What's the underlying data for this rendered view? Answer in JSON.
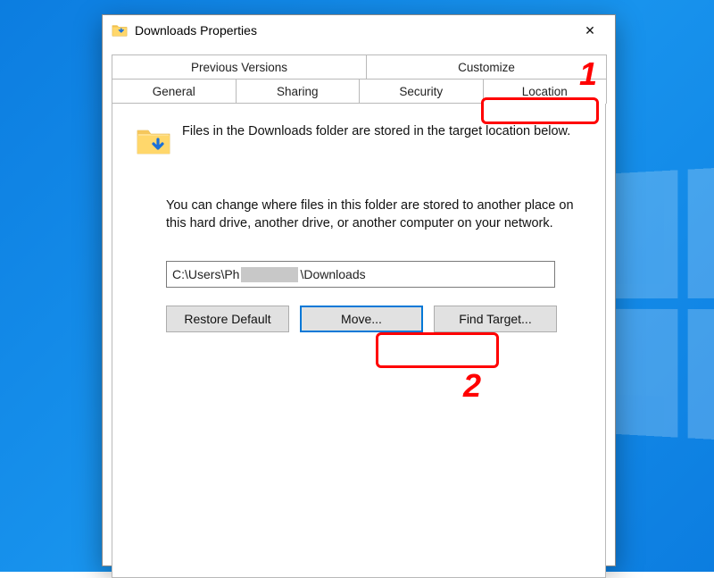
{
  "window": {
    "title": "Downloads Properties",
    "close_glyph": "✕"
  },
  "tabs": {
    "row1": {
      "previous_versions": "Previous Versions",
      "customize": "Customize"
    },
    "row2": {
      "general": "General",
      "sharing": "Sharing",
      "security": "Security",
      "location": "Location"
    }
  },
  "location_tab": {
    "intro": "Files in the Downloads folder are stored in the target location below.",
    "explain": "You can change where files in this folder are stored to another place on this hard drive, another drive, or another computer on your network.",
    "path_prefix": "C:\\Users\\Ph",
    "path_suffix": "\\Downloads",
    "buttons": {
      "restore": "Restore Default",
      "move": "Move...",
      "find": "Find Target..."
    }
  },
  "annotations": {
    "n1": "1",
    "n2": "2"
  }
}
